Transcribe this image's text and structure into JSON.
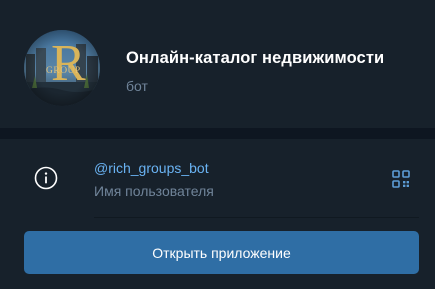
{
  "header": {
    "title": "Онлайн-каталог недвижимости",
    "subtitle": "бот",
    "avatar": {
      "icon": "logo-avatar",
      "logo_letter": "R",
      "logo_word": "GROUP",
      "accent_color": "#d9b45a"
    }
  },
  "info": {
    "icon": "info-icon",
    "username": "@rich_groups_bot",
    "username_caption": "Имя пользователя",
    "qr_icon": "qr-code-icon",
    "link_color": "#6ab3f3"
  },
  "actions": {
    "open_app_label": "Открыть приложение",
    "button_color": "#2f6ea5"
  }
}
